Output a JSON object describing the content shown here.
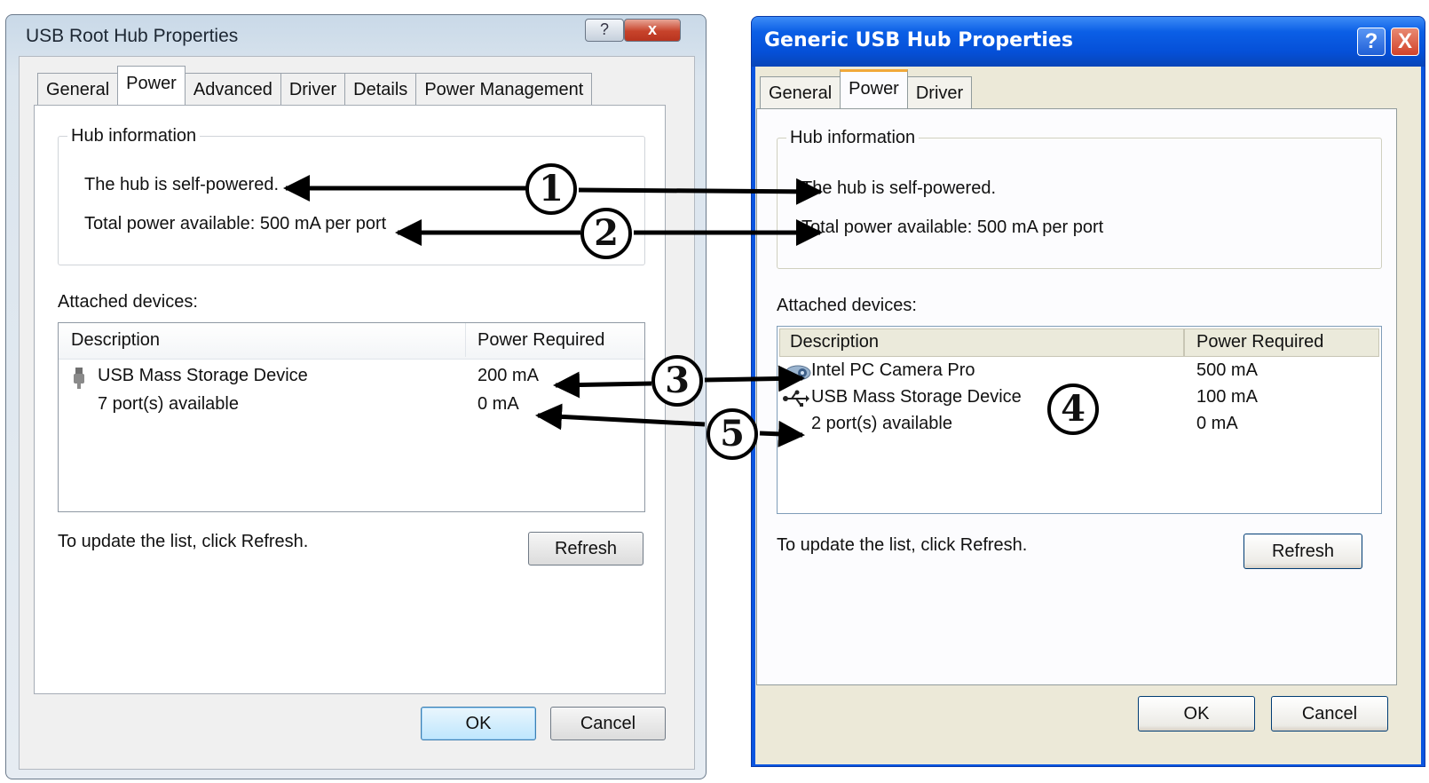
{
  "vista": {
    "title": "USB Root Hub Properties",
    "help_glyph": "?",
    "close_glyph": "x",
    "tabs": [
      "General",
      "Power",
      "Advanced",
      "Driver",
      "Details",
      "Power Management"
    ],
    "active_tab": "Power",
    "hub_info_legend": "Hub information",
    "self_powered": "The hub is self-powered.",
    "total_power": "Total power available:  500 mA per port",
    "attached_label": "Attached devices:",
    "columns": [
      "Description",
      "Power Required"
    ],
    "rows": [
      {
        "description": "USB Mass Storage Device",
        "power": "200 mA",
        "icon": "usb-plug-icon"
      },
      {
        "description": "7 port(s) available",
        "power": "0 mA"
      }
    ],
    "update_hint": "To update the list, click Refresh.",
    "refresh": "Refresh",
    "ok": "OK",
    "cancel": "Cancel"
  },
  "xp": {
    "title": "Generic USB Hub Properties",
    "help_glyph": "?",
    "close_glyph": "X",
    "tabs": [
      "General",
      "Power",
      "Driver"
    ],
    "active_tab": "Power",
    "hub_info_legend": "Hub information",
    "self_powered": "The hub is self-powered.",
    "total_power": "Total power available:  500 mA per port",
    "attached_label": "Attached devices:",
    "columns": [
      "Description",
      "Power Required"
    ],
    "rows": [
      {
        "description": "Intel PC Camera Pro",
        "power": "500 mA",
        "icon": "camera-icon"
      },
      {
        "description": "USB Mass Storage Device",
        "power": "100 mA",
        "icon": "usb-symbol-icon"
      },
      {
        "description": "2 port(s) available",
        "power": "0 mA"
      }
    ],
    "update_hint": "To update the list, click Refresh.",
    "refresh": "Refresh",
    "ok": "OK",
    "cancel": "Cancel"
  },
  "callouts": [
    "1",
    "2",
    "3",
    "4",
    "5"
  ]
}
